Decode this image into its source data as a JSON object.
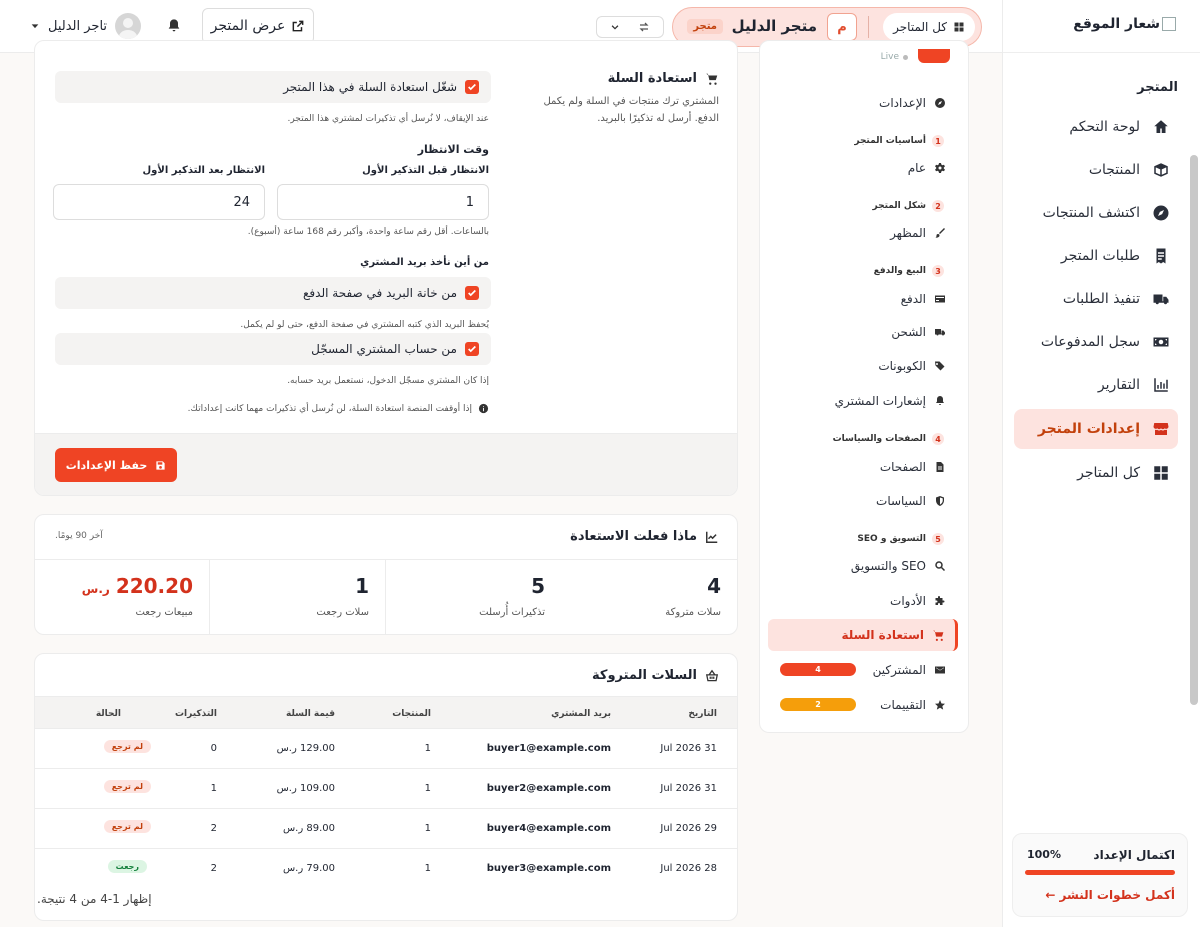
{
  "sidebar": {
    "logo_text": "شعار الموقع",
    "section_label": "المتجر",
    "items": [
      {
        "label": "لوحة التحكم",
        "icon": "home-icon"
      },
      {
        "label": "المنتجات",
        "icon": "box-icon"
      },
      {
        "label": "اكتشف المنتجات",
        "icon": "compass-icon"
      },
      {
        "label": "طلبات المتجر",
        "icon": "receipt-icon"
      },
      {
        "label": "تنفيذ الطلبات",
        "icon": "truck-icon"
      },
      {
        "label": "سجل المدفوعات",
        "icon": "money-icon"
      },
      {
        "label": "التقارير",
        "icon": "chart-icon"
      },
      {
        "label": "إعدادات المتجر",
        "icon": "store-icon"
      },
      {
        "label": "كل المتاجر",
        "icon": "grid-icon"
      }
    ],
    "setup": {
      "title": "اكتمال الإعداد",
      "percent": "100%",
      "progress": 1.0,
      "link": "أكمل خطوات النشر ←"
    }
  },
  "topbar": {
    "all_stores": "كل المتاجر",
    "store_initial": "م",
    "store_name": "متجر الدليل",
    "store_badge": "متجر",
    "view_store": "عرض المتجر",
    "user_name": "تاجر الدليل"
  },
  "subnav": {
    "live": "Live",
    "settings": "الإعدادات",
    "groups": [
      {
        "num": "1",
        "label": "أساسيات المتجر"
      },
      {
        "num": "2",
        "label": "شكل المتجر"
      },
      {
        "num": "3",
        "label": "البيع والدفع"
      },
      {
        "num": "4",
        "label": "الصفحات والسياسات"
      },
      {
        "num": "5",
        "label": "التسويق و SEO"
      }
    ],
    "items": {
      "general": "عام",
      "appearance": "المظهر",
      "payment": "الدفع",
      "shipping": "الشحن",
      "coupons": "الكوبونات",
      "notifications": "إشعارات المشتري",
      "pages": "الصفحات",
      "policies": "السياسات",
      "seo": "SEO والتسويق",
      "tools": "الأدوات",
      "cart_recovery": "استعادة السلة",
      "subscribers": "المشتركين",
      "reviews": "التقييمات"
    },
    "subscribers_count": "4",
    "reviews_count": "2",
    "colors": {
      "accent": "#ef4424",
      "reviews": "#f59e0b"
    }
  },
  "settings": {
    "title": "استعادة السلة",
    "description": "المشتري ترك منتجات في السلة ولم يكمل الدفع. أرسل له تذكيرًا بالبريد.",
    "enable_label": "شغّل استعادة السلة في هذا المتجر",
    "enable_help": "عند الإيقاف، لا نُرسل أي تذكيرات لمشتري هذا المتجر.",
    "wait_title": "وقت الانتظار",
    "before_label": "الانتظار قبل التذكير الأول",
    "before_value": "1",
    "after_label": "الانتظار بعد التذكير الأول",
    "after_value": "24",
    "hours_help": "بالساعات. أقل رقم ساعة واحدة، وأكبر رقم 168 ساعة (أسبوع).",
    "email_source_title": "من أين نأخذ بريد المشتري",
    "checkout_label": "من خانة البريد في صفحة الدفع",
    "checkout_help": "يُحفظ البريد الذي كتبه المشتري في صفحة الدفع، حتى لو لم يكمل.",
    "account_label": "من حساب المشتري المسجّل",
    "account_help": "إذا كان المشتري مسجّل الدخول، نستعمل بريد حسابه.",
    "platform_note": "إذا أوقفت المنصة استعادة السلة، لن نُرسل أي تذكيرات مهما كانت إعداداتك.",
    "save_label": "حفظ الإعدادات"
  },
  "stats": {
    "title": "ماذا فعلت الاستعادة",
    "note": "آخر 90 يومًا.",
    "items": [
      {
        "value": "4",
        "label": "سلات متروكة"
      },
      {
        "value": "5",
        "label": "تذكيرات أُرسلت"
      },
      {
        "value": "1",
        "label": "سلات رجعت"
      },
      {
        "value": "220.20",
        "currency": "ر.س",
        "label": "مبيعات رجعت"
      }
    ]
  },
  "table": {
    "title": "السلات المتروكة",
    "headers": [
      "التاريخ",
      "بريد المشتري",
      "المنتجات",
      "قيمة السلة",
      "التذكيرات",
      "الحالة"
    ],
    "rows": [
      {
        "date": "31 Jul 2026",
        "email": "buyer1@example.com",
        "products": "1",
        "value": "129.00 ر.س",
        "reminders": "0",
        "status": "لم ترجع",
        "returned": false
      },
      {
        "date": "31 Jul 2026",
        "email": "buyer2@example.com",
        "products": "1",
        "value": "109.00 ر.س",
        "reminders": "1",
        "status": "لم ترجع",
        "returned": false
      },
      {
        "date": "29 Jul 2026",
        "email": "buyer4@example.com",
        "products": "1",
        "value": "89.00 ر.س",
        "reminders": "2",
        "status": "لم ترجع",
        "returned": false
      },
      {
        "date": "28 Jul 2026",
        "email": "buyer3@example.com",
        "products": "1",
        "value": "79.00 ر.س",
        "reminders": "2",
        "status": "رجعت",
        "returned": true
      }
    ],
    "footer": "إظهار 1-4 من 4 نتيجة."
  }
}
